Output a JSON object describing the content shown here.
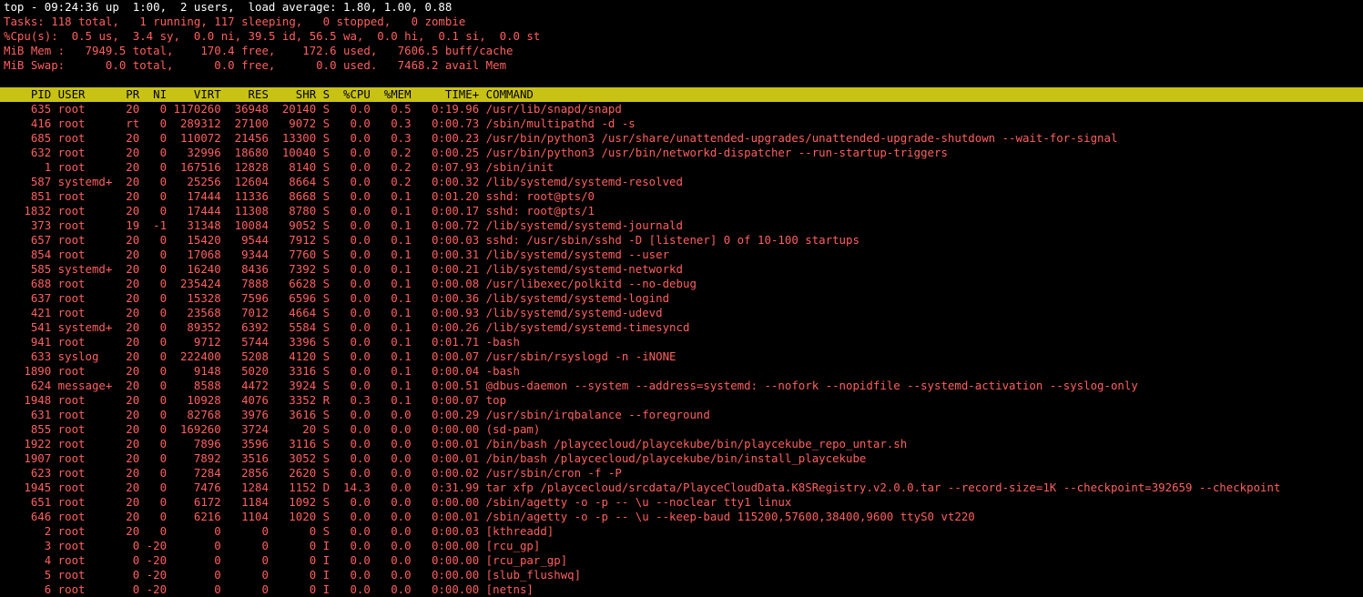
{
  "summary": {
    "top_line": "top - 09:24:36 up  1:00,  2 users,  load average: 1.80, 1.00, 0.88",
    "tasks_label": "Tasks:",
    "tasks_value": " 118 total,   1 running, 117 sleeping,   0 stopped,   0 zombie",
    "cpu_label": "%Cpu(s):",
    "cpu_value": "  0.5 us,  3.4 sy,  0.0 ni, 39.5 id, 56.5 wa,  0.0 hi,  0.1 si,  0.0 st",
    "mem_label": "MiB Mem :",
    "mem_value": "   7949.5 total,    170.4 free,    172.6 used,   7606.5 buff/cache",
    "swap_label": "MiB Swap:",
    "swap_value": "      0.0 total,      0.0 free,      0.0 used.   7468.2 avail Mem"
  },
  "table": {
    "header": "    PID USER      PR  NI    VIRT    RES    SHR S  %CPU  %MEM     TIME+ COMMAND",
    "rows": [
      "    635 root      20   0 1170260  36948  20140 S   0.0   0.5   0:19.96 /usr/lib/snapd/snapd",
      "    416 root      rt   0  289312  27100   9072 S   0.0   0.3   0:00.73 /sbin/multipathd -d -s",
      "    685 root      20   0  110072  21456  13300 S   0.0   0.3   0:00.23 /usr/bin/python3 /usr/share/unattended-upgrades/unattended-upgrade-shutdown --wait-for-signal",
      "    632 root      20   0   32996  18680  10040 S   0.0   0.2   0:00.25 /usr/bin/python3 /usr/bin/networkd-dispatcher --run-startup-triggers",
      "      1 root      20   0  167516  12828   8140 S   0.0   0.2   0:07.93 /sbin/init",
      "    587 systemd+  20   0   25256  12604   8664 S   0.0   0.2   0:00.32 /lib/systemd/systemd-resolved",
      "    851 root      20   0   17444  11336   8668 S   0.0   0.1   0:01.20 sshd: root@pts/0",
      "   1832 root      20   0   17444  11308   8780 S   0.0   0.1   0:00.17 sshd: root@pts/1",
      "    373 root      19  -1   31348  10084   9052 S   0.0   0.1   0:00.72 /lib/systemd/systemd-journald",
      "    657 root      20   0   15420   9544   7912 S   0.0   0.1   0:00.03 sshd: /usr/sbin/sshd -D [listener] 0 of 10-100 startups",
      "    854 root      20   0   17068   9344   7760 S   0.0   0.1   0:00.31 /lib/systemd/systemd --user",
      "    585 systemd+  20   0   16240   8436   7392 S   0.0   0.1   0:00.21 /lib/systemd/systemd-networkd",
      "    688 root      20   0  235424   7888   6628 S   0.0   0.1   0:00.08 /usr/libexec/polkitd --no-debug",
      "    637 root      20   0   15328   7596   6596 S   0.0   0.1   0:00.36 /lib/systemd/systemd-logind",
      "    421 root      20   0   23568   7012   4664 S   0.0   0.1   0:00.93 /lib/systemd/systemd-udevd",
      "    541 systemd+  20   0   89352   6392   5584 S   0.0   0.1   0:00.26 /lib/systemd/systemd-timesyncd",
      "    941 root      20   0    9712   5744   3396 S   0.0   0.1   0:01.71 -bash",
      "    633 syslog    20   0  222400   5208   4120 S   0.0   0.1   0:00.07 /usr/sbin/rsyslogd -n -iNONE",
      "   1890 root      20   0    9148   5020   3316 S   0.0   0.1   0:00.04 -bash",
      "    624 message+  20   0    8588   4472   3924 S   0.0   0.1   0:00.51 @dbus-daemon --system --address=systemd: --nofork --nopidfile --systemd-activation --syslog-only",
      "   1948 root      20   0   10928   4076   3352 R   0.3   0.1   0:00.07 top",
      "    631 root      20   0   82768   3976   3616 S   0.0   0.0   0:00.29 /usr/sbin/irqbalance --foreground",
      "    855 root      20   0  169260   3724     20 S   0.0   0.0   0:00.00 (sd-pam)",
      "   1922 root      20   0    7896   3596   3116 S   0.0   0.0   0:00.01 /bin/bash /playcecloud/playcekube/bin/playcekube_repo_untar.sh",
      "   1907 root      20   0    7892   3516   3052 S   0.0   0.0   0:00.01 /bin/bash /playcecloud/playcekube/bin/install_playcekube",
      "    623 root      20   0    7284   2856   2620 S   0.0   0.0   0:00.02 /usr/sbin/cron -f -P",
      "   1945 root      20   0    7476   1284   1152 D  14.3   0.0   0:31.99 tar xfp /playcecloud/srcdata/PlayceCloudData.K8SRegistry.v2.0.0.tar --record-size=1K --checkpoint=392659 --checkpoint",
      "    651 root      20   0    6172   1184   1092 S   0.0   0.0   0:00.00 /sbin/agetty -o -p -- \\u --noclear tty1 linux",
      "    646 root      20   0    6216   1104   1020 S   0.0   0.0   0:00.01 /sbin/agetty -o -p -- \\u --keep-baud 115200,57600,38400,9600 ttyS0 vt220",
      "      2 root      20   0       0      0      0 S   0.0   0.0   0:00.03 [kthreadd]",
      "      3 root       0 -20       0      0      0 I   0.0   0.0   0:00.00 [rcu_gp]",
      "      4 root       0 -20       0      0      0 I   0.0   0.0   0:00.00 [rcu_par_gp]",
      "      5 root       0 -20       0      0      0 I   0.0   0.0   0:00.00 [slub_flushwq]",
      "      6 root       0 -20       0      0      0 I   0.0   0.0   0:00.00 [netns]"
    ]
  },
  "colors": {
    "background": "#000000",
    "text_red": "#ff5f5f",
    "text_white": "#ffffff",
    "header_bar": "#c8c214"
  }
}
